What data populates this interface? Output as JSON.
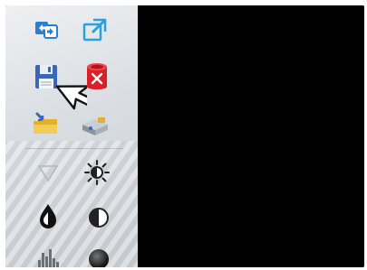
{
  "toolbar": {
    "tools": [
      {
        "icon": "layer-swap-icon",
        "color": "#2a7fd4"
      },
      {
        "icon": "expand-window-icon",
        "color": "#2aa0dc"
      },
      {
        "icon": "save-disk-icon",
        "color": "#3a66b8"
      },
      {
        "icon": "delete-database-icon",
        "color": "#d8202a"
      },
      {
        "icon": "open-folder-icon",
        "color": "#e3b02c"
      },
      {
        "icon": "scanner-import-icon",
        "color": "#8a949c"
      },
      {
        "icon": "triangle-filter-icon",
        "color": "#b0b8c0"
      },
      {
        "icon": "brightness-sun-icon",
        "color": "#222222"
      },
      {
        "icon": "contrast-drop-icon",
        "color": "#111111"
      },
      {
        "icon": "half-contrast-icon",
        "color": "#222222"
      },
      {
        "icon": "histogram-icon",
        "color": "#6a7076"
      },
      {
        "icon": "gradient-sphere-icon",
        "color": "#222222"
      }
    ]
  },
  "colors": {
    "toolbar_bg": "#d9dde1",
    "viewport_bg": "#000000"
  }
}
